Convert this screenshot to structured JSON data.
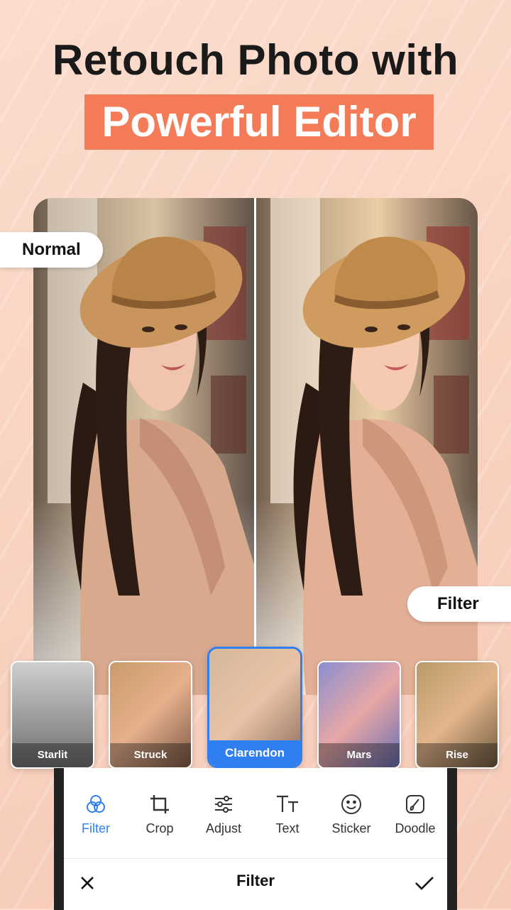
{
  "headline": "Retouch Photo with",
  "banner": "Powerful Editor",
  "compare": {
    "left_tag": "Normal",
    "right_tag": "Filter"
  },
  "filters": [
    {
      "label": "Starlit",
      "active": false
    },
    {
      "label": "Struck",
      "active": false
    },
    {
      "label": "Clarendon",
      "active": true
    },
    {
      "label": "Mars",
      "active": false
    },
    {
      "label": "Rise",
      "active": false
    }
  ],
  "tools": [
    {
      "label": "Filter",
      "icon": "filter-icon",
      "active": true
    },
    {
      "label": "Crop",
      "icon": "crop-icon",
      "active": false
    },
    {
      "label": "Adjust",
      "icon": "sliders-icon",
      "active": false
    },
    {
      "label": "Text",
      "icon": "text-icon",
      "active": false
    },
    {
      "label": "Sticker",
      "icon": "smiley-icon",
      "active": false
    },
    {
      "label": "Doodle",
      "icon": "brush-icon",
      "active": false
    }
  ],
  "bottom_bar": {
    "title": "Filter",
    "close_icon": "close-icon",
    "confirm_icon": "check-icon"
  },
  "colors": {
    "accent": "#f47b58",
    "active_blue": "#2f7ff0",
    "background": "#f9d3c1"
  }
}
